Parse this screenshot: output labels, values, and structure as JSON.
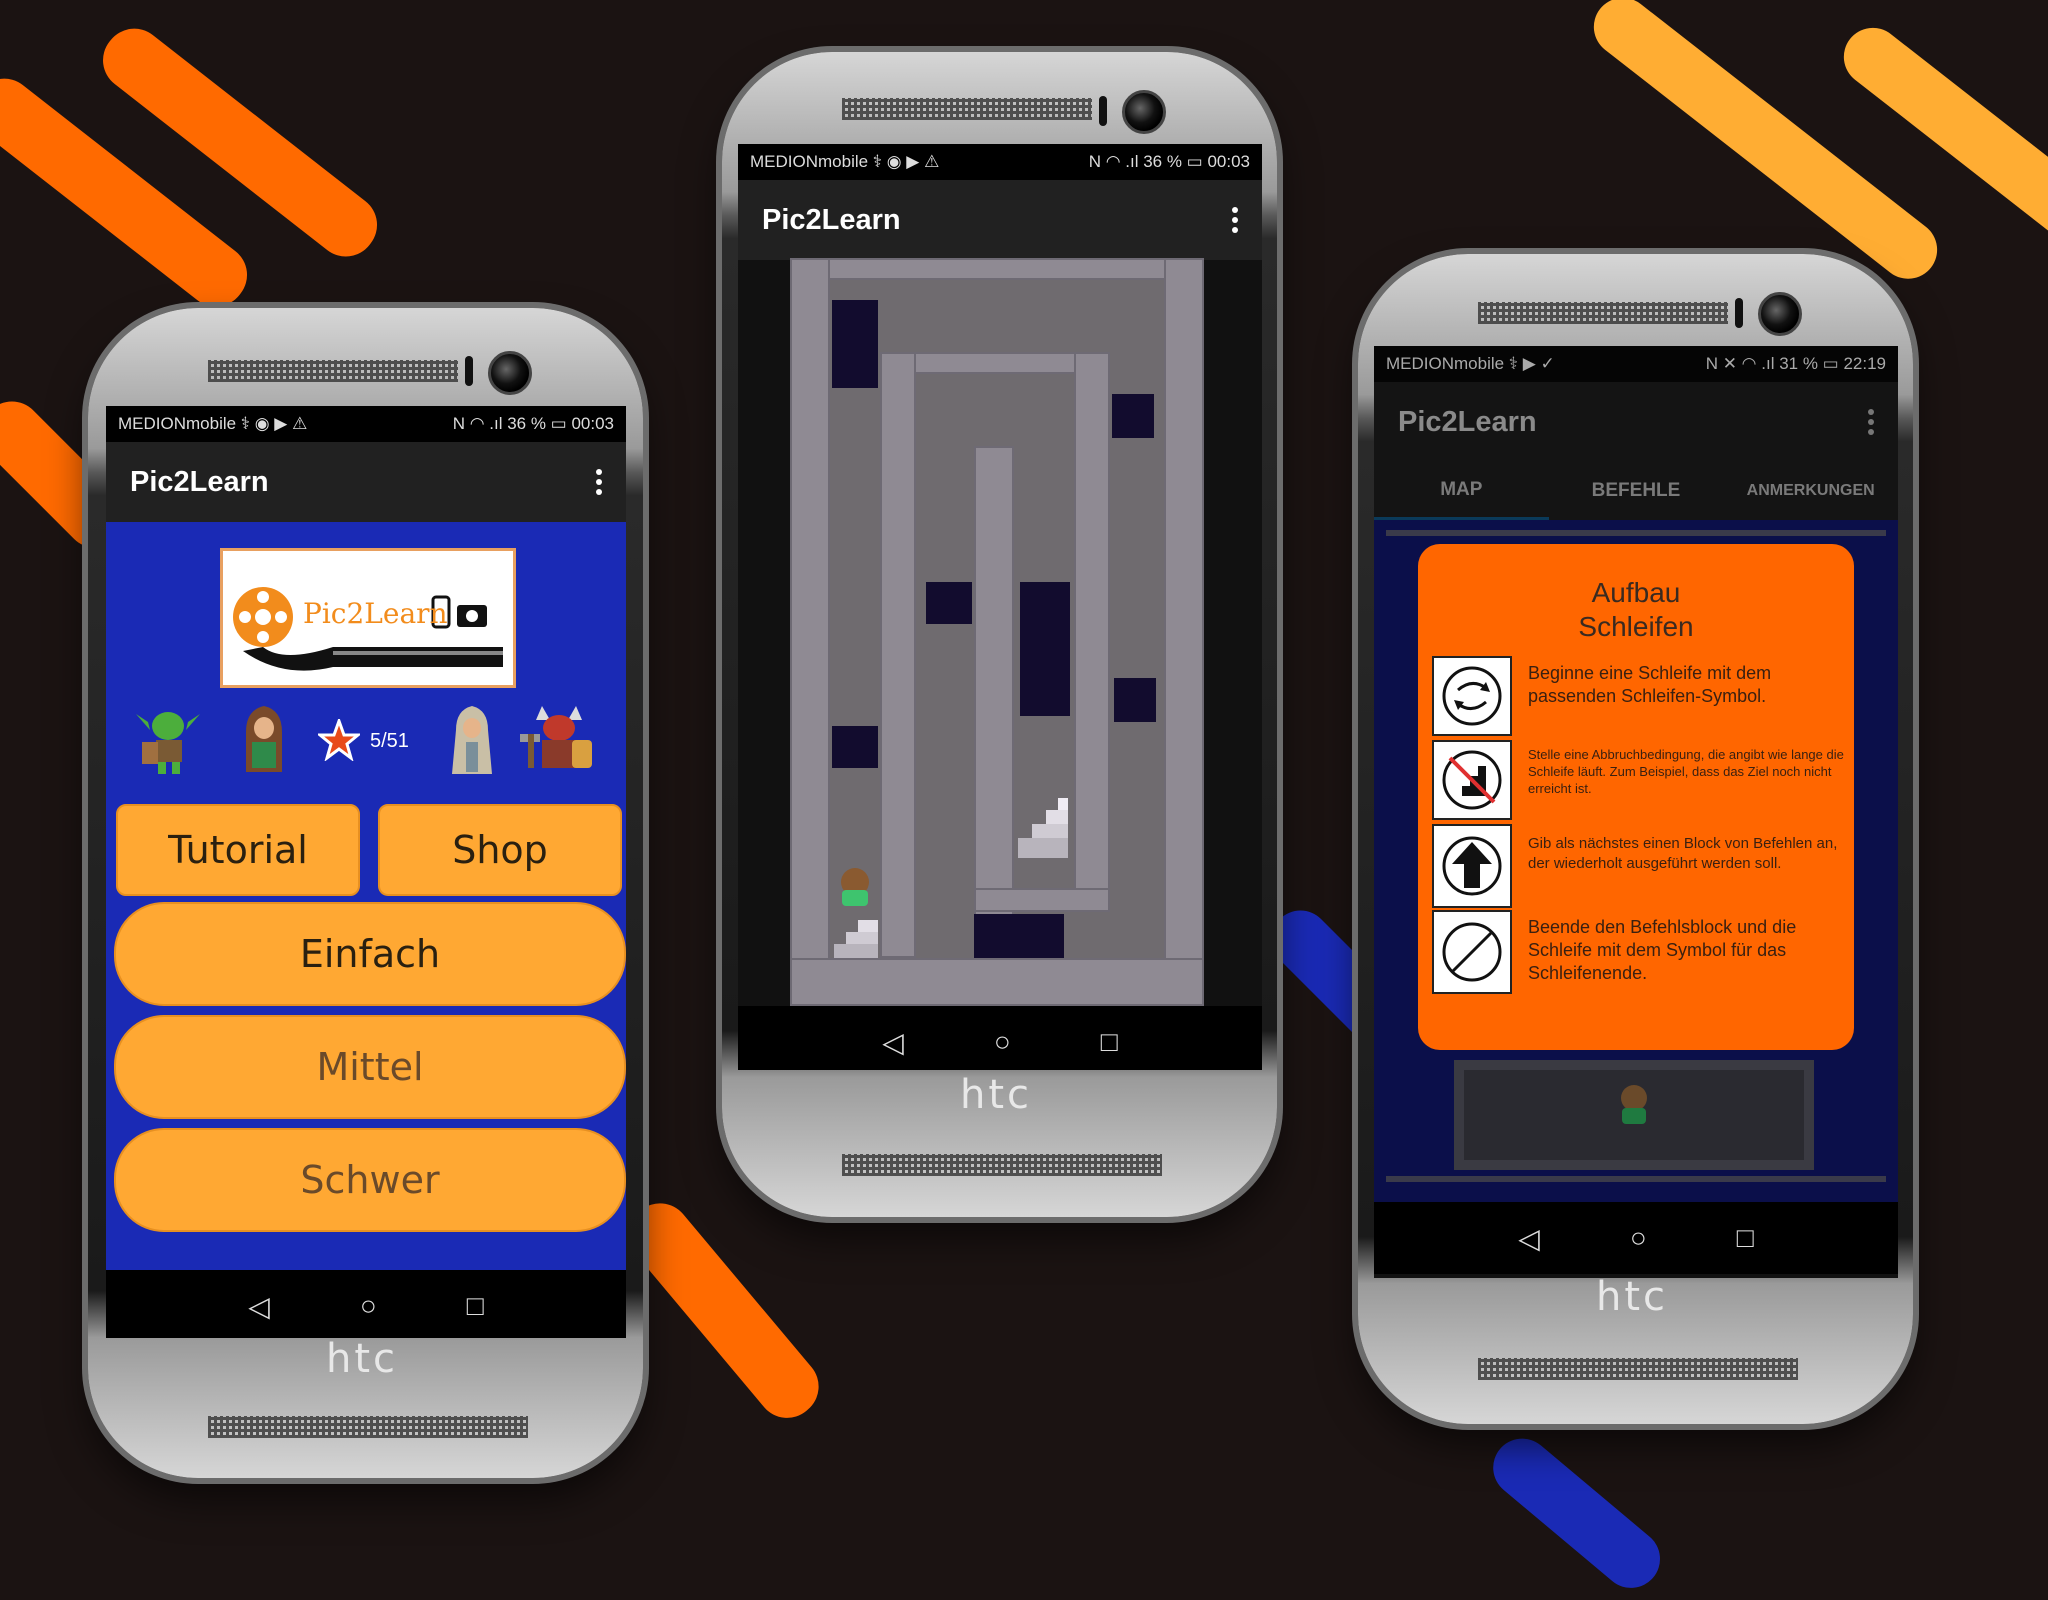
{
  "colors": {
    "background": "#1b1312",
    "orange": "#ff6a00",
    "light_orange": "#ffad33",
    "blue": "#1a2ab5",
    "panel_orange": "#ff6600",
    "button_orange": "#ffa833"
  },
  "phone_left": {
    "status": {
      "carrier": "MEDIONmobile ⚕ ◉ ▶ ⚠",
      "right": "N ◠ .ıl 36 % ▭ 00:03"
    },
    "app_title": "Pic2Learn",
    "logo_text": "Pic2Learn",
    "stars": "5/51",
    "buttons": {
      "tutorial": "Tutorial",
      "shop": "Shop",
      "easy": "Einfach",
      "medium": "Mittel",
      "hard": "Schwer"
    },
    "brand": "htc"
  },
  "phone_middle": {
    "status": {
      "carrier": "MEDIONmobile ⚕ ◉ ▶ ⚠",
      "right": "N ◠ .ıl 36 % ▭ 00:03"
    },
    "app_title": "Pic2Learn",
    "brand": "htc"
  },
  "phone_right": {
    "status": {
      "carrier": "MEDIONmobile ⚕ ▶ ✓",
      "right": "N ✕ ◠ .ıl 31 % ▭ 22:19"
    },
    "app_title": "Pic2Learn",
    "tabs": [
      "MAP",
      "BEFEHLE",
      "ANMERKUNGEN"
    ],
    "dialog": {
      "title_line1": "Aufbau",
      "title_line2": "Schleifen",
      "steps": [
        {
          "icon": "loop-icon",
          "text": "Beginne eine Schleife mit dem passenden Schleifen-Symbol."
        },
        {
          "icon": "no-stairs-icon",
          "text": "Stelle eine Abbruchbedingung, die angibt wie lange die Schleife läuft. Zum Beispiel, dass das Ziel noch nicht erreicht ist."
        },
        {
          "icon": "arrow-up-icon",
          "text": "Gib als nächstes einen Block von Befehlen an, der wiederholt ausgeführt werden soll."
        },
        {
          "icon": "loop-end-icon",
          "text": "Beende den Befehlsblock und die Schleife mit dem Symbol für das Schleifenende."
        }
      ]
    },
    "brand": "htc"
  },
  "nav": {
    "back": "◁",
    "home": "○",
    "recents": "□"
  }
}
